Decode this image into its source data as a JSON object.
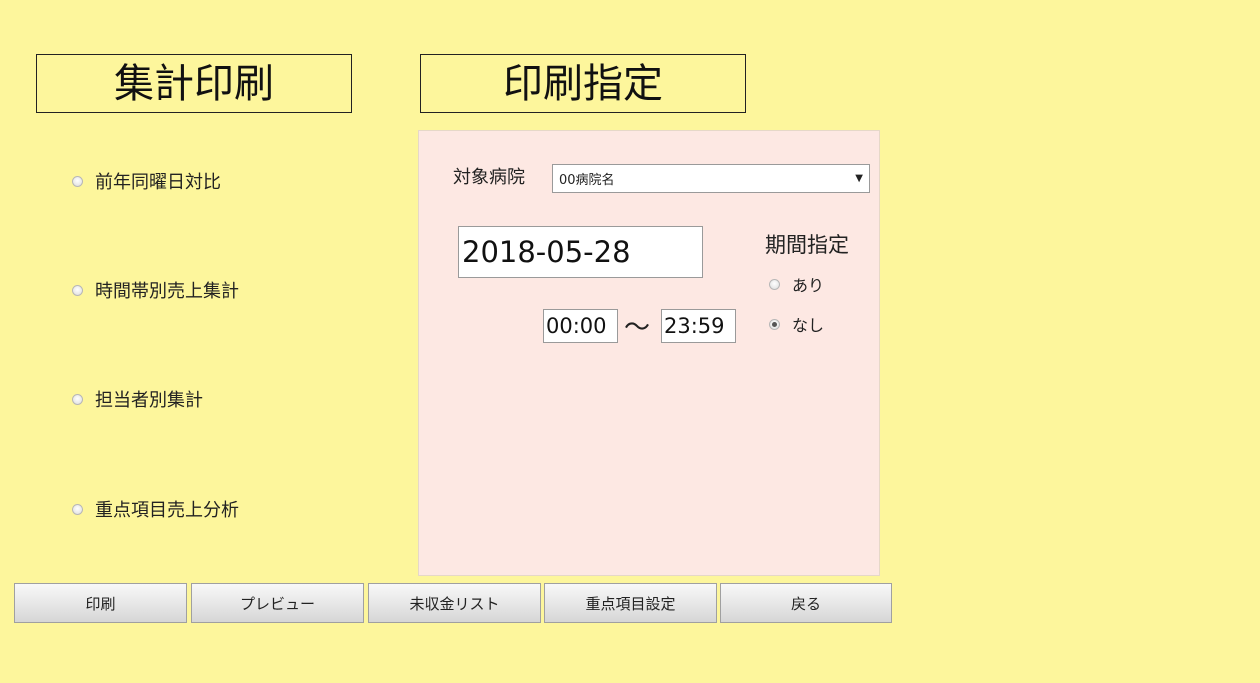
{
  "titles": {
    "summary_print": "集計印刷",
    "print_settings": "印刷指定"
  },
  "report_options": [
    {
      "label": "前年同曜日対比",
      "selected": false
    },
    {
      "label": "時間帯別売上集計",
      "selected": false
    },
    {
      "label": "担当者別集計",
      "selected": false
    },
    {
      "label": "重点項目売上分析",
      "selected": false
    }
  ],
  "settings": {
    "hospital_label": "対象病院",
    "hospital_value": "00病院名",
    "date_value": "2018-05-28",
    "time_start": "00:00",
    "time_separator": "〜",
    "time_end": "23:59",
    "period_label": "期間指定",
    "period_options": [
      {
        "label": "あり",
        "selected": false
      },
      {
        "label": "なし",
        "selected": true
      }
    ]
  },
  "buttons": {
    "print": "印刷",
    "preview": "プレビュー",
    "unpaid_list": "未収金リスト",
    "priority_settings": "重点項目設定",
    "back": "戻る"
  },
  "colors": {
    "background": "#fdf69c",
    "panel_background": "#fde8e3"
  }
}
